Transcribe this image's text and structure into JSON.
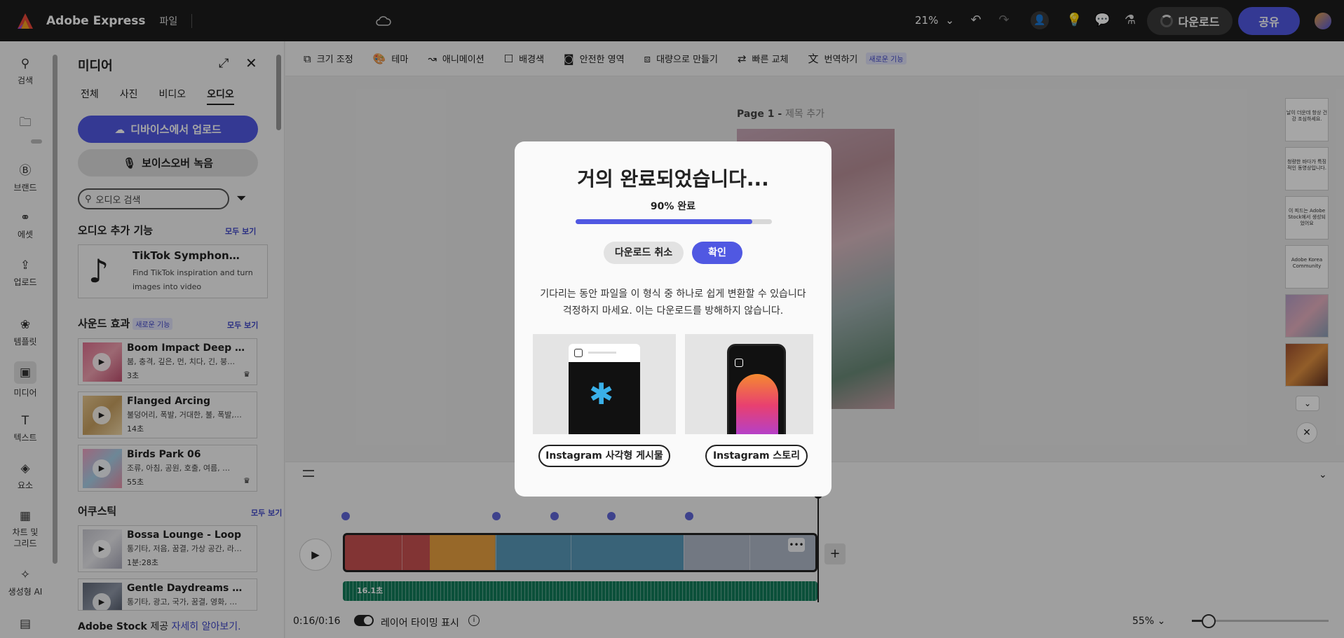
{
  "topbar": {
    "app_name": "Adobe Express",
    "file_menu": "파일",
    "zoom": "21%",
    "download_label": "다운로드",
    "share_label": "공유"
  },
  "rail": {
    "items": [
      {
        "label": "검색",
        "icon": "search-icon"
      },
      {
        "label": "",
        "icon": "folder-icon"
      },
      {
        "label": "브랜드",
        "icon": "brand-icon"
      },
      {
        "label": "에셋",
        "icon": "assets-icon"
      },
      {
        "label": "업로드",
        "icon": "upload-icon"
      },
      {
        "label": "템플릿",
        "icon": "template-icon"
      },
      {
        "label": "미디어",
        "icon": "media-icon"
      },
      {
        "label": "텍스트",
        "icon": "text-icon"
      },
      {
        "label": "요소",
        "icon": "elements-icon"
      },
      {
        "label": "차트 및 그리드",
        "icon": "chart-icon"
      },
      {
        "label": "생성형 AI",
        "icon": "ai-icon"
      }
    ]
  },
  "panel": {
    "title": "미디어",
    "tabs": [
      "전체",
      "사진",
      "비디오",
      "오디오"
    ],
    "active_tab": "오디오",
    "upload_label": "디바이스에서 업로드",
    "voice_label": "보이스오버 녹음",
    "search_placeholder": "오디오 검색",
    "addons_title": "오디오 추가 기능",
    "see_all": "모두 보기",
    "tiktok": {
      "title": "TikTok Symphony…",
      "desc": "Find TikTok inspiration and turn images into video"
    },
    "sfx_title": "사운드 효과",
    "new_badge": "새로운 기능",
    "sfx": [
      {
        "title": "Boom Impact Deep D…",
        "tags": "붐, 충격, 깊은, 먼, 치다, 긴, 붕…",
        "duration": "3초"
      },
      {
        "title": "Flanged Arcing",
        "tags": "불덩어리, 폭발, 거대한, 불, 폭발,…",
        "duration": "14초"
      },
      {
        "title": "Birds Park 06",
        "tags": "조류, 아침, 공원, 호출, 여름, …",
        "duration": "55초"
      }
    ],
    "acoustic_title": "어쿠스틱",
    "acoustic": [
      {
        "title": "Bossa Lounge - Loop",
        "tags": "통기타, 저음, 꿈결, 가상 공간, 라…",
        "duration": "1분:28초"
      },
      {
        "title": "Gentle Daydreams - Lo…",
        "tags": "통기타, 광고, 국가, 꿈결, 영화, …",
        "duration": ""
      }
    ],
    "stock_brand": "Adobe Stock",
    "stock_text": "제공",
    "stock_link": "자세히 알아보기."
  },
  "ctx_toolbar": [
    {
      "label": "크기 조정",
      "icon": "resize-icon"
    },
    {
      "label": "테마",
      "icon": "theme-icon"
    },
    {
      "label": "애니메이션",
      "icon": "animation-icon"
    },
    {
      "label": "배경색",
      "icon": "background-icon"
    },
    {
      "label": "안전한 영역",
      "icon": "safe-area-icon"
    },
    {
      "label": "대량으로 만들기",
      "icon": "bulk-create-icon"
    },
    {
      "label": "빠른 교체",
      "icon": "quick-swap-icon"
    },
    {
      "label": "번역하기",
      "icon": "translate-icon"
    }
  ],
  "ctx_new_badge": "새로운 기능",
  "canvas": {
    "page_label": "Page 1 -",
    "page_title_placeholder": "제목 추가",
    "thumbs": [
      "날이 더운데 항상 건강 조심하세요.",
      "청량한 바다가 특징적인 동영상입니다.",
      "이 피드는 Adobe Stock에서 생성되었어요",
      "Adobe Korea Community",
      "",
      ""
    ]
  },
  "timeline": {
    "audio_label": "16.1초",
    "time": "0:16/0:16",
    "layer_timing": "레이어 타이밍 표시",
    "zoom": "55%"
  },
  "modal": {
    "title": "거의 완료되었습니다...",
    "progress_label": "90% 완료",
    "progress": 0.9,
    "cancel_label": "다운로드 취소",
    "ok_label": "확인",
    "desc_line1": "기다리는 동안 파일을 이 형식 중 하나로 쉽게 변환할 수 있습니다",
    "desc_line2": "걱정하지 마세요. 이는 다운로드를 방해하지 않습니다.",
    "options": [
      "Instagram 사각형 게시물",
      "Instagram 스토리"
    ]
  },
  "colors": {
    "accent": "#5058e2",
    "topbar": "#1d1d1d",
    "audio_track": "#127b5a"
  }
}
